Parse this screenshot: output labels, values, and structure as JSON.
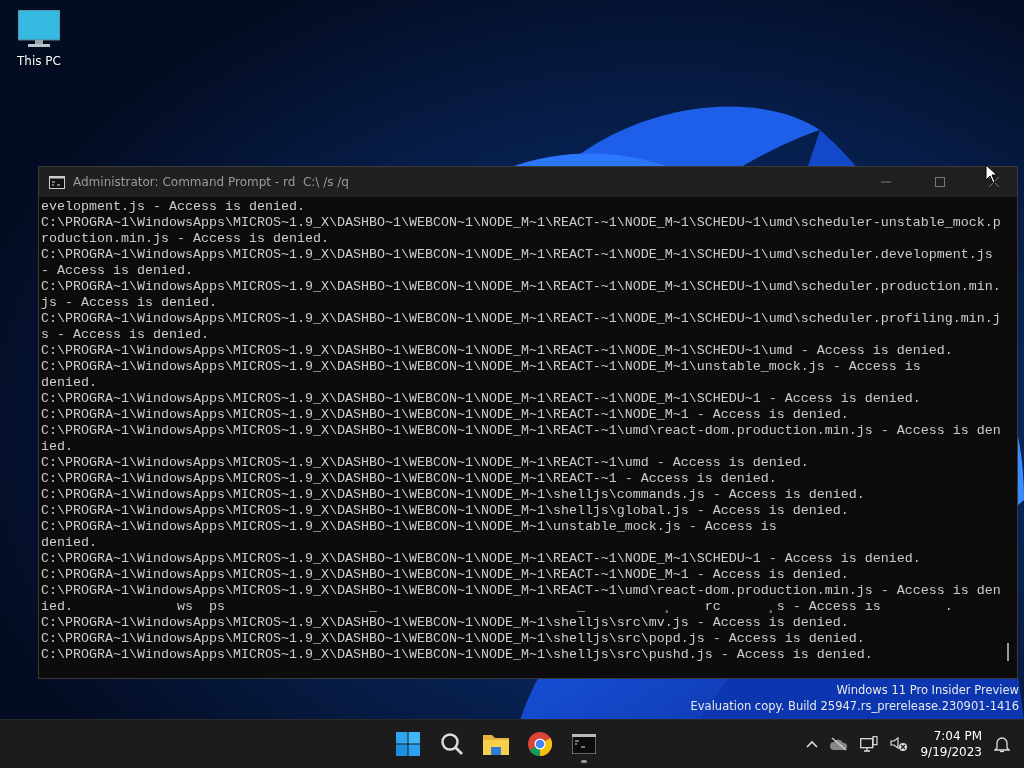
{
  "desktop_icons": [
    {
      "label": "This PC"
    }
  ],
  "window": {
    "title": "Administrator: Command Prompt - rd  C:\\ /s /q",
    "console_lines": [
      "evelopment.js - Access is denied.",
      "C:\\PROGRA~1\\WindowsApps\\MICROS~1.9_X\\DASHBO~1\\WEBCON~1\\NODE_M~1\\REACT-~1\\NODE_M~1\\SCHEDU~1\\umd\\scheduler-unstable_mock.p",
      "roduction.min.js - Access is denied.",
      "C:\\PROGRA~1\\WindowsApps\\MICROS~1.9_X\\DASHBO~1\\WEBCON~1\\NODE_M~1\\REACT-~1\\NODE_M~1\\SCHEDU~1\\umd\\scheduler.development.js",
      "- Access is denied.",
      "C:\\PROGRA~1\\WindowsApps\\MICROS~1.9_X\\DASHBO~1\\WEBCON~1\\NODE_M~1\\REACT-~1\\NODE_M~1\\SCHEDU~1\\umd\\scheduler.production.min.",
      "js - Access is denied.",
      "C:\\PROGRA~1\\WindowsApps\\MICROS~1.9_X\\DASHBO~1\\WEBCON~1\\NODE_M~1\\REACT-~1\\NODE_M~1\\SCHEDU~1\\umd\\scheduler.profiling.min.j",
      "s - Access is denied.",
      "C:\\PROGRA~1\\WindowsApps\\MICROS~1.9_X\\DASHBO~1\\WEBCON~1\\NODE_M~1\\REACT-~1\\NODE_M~1\\SCHEDU~1\\umd - Access is denied.",
      "C:\\PROGRA~1\\WindowsApps\\MICROS~1.9_X\\DASHBO~1\\WEBCON~1\\NODE_M~1\\REACT-~1\\NODE_M~1\\unstable_mock.js - Access is",
      "denied.",
      "C:\\PROGRA~1\\WindowsApps\\MICROS~1.9_X\\DASHBO~1\\WEBCON~1\\NODE_M~1\\REACT-~1\\NODE_M~1\\SCHEDU~1 - Access is denied.",
      "C:\\PROGRA~1\\WindowsApps\\MICROS~1.9_X\\DASHBO~1\\WEBCON~1\\NODE_M~1\\REACT-~1\\NODE_M~1 - Access is denied.",
      "C:\\PROGRA~1\\WindowsApps\\MICROS~1.9_X\\DASHBO~1\\WEBCON~1\\NODE_M~1\\REACT-~1\\umd\\react-dom.production.min.js - Access is den",
      "ied.",
      "C:\\PROGRA~1\\WindowsApps\\MICROS~1.9_X\\DASHBO~1\\WEBCON~1\\NODE_M~1\\REACT-~1\\umd - Access is denied.",
      "C:\\PROGRA~1\\WindowsApps\\MICROS~1.9_X\\DASHBO~1\\WEBCON~1\\NODE_M~1\\REACT-~1 - Access is denied.",
      "C:\\PROGRA~1\\WindowsApps\\MICROS~1.9_X\\DASHBO~1\\WEBCON~1\\NODE_M~1\\shelljs\\commands.js - Access is denied.",
      "C:\\PROGRA~1\\WindowsApps\\MICROS~1.9_X\\DASHBO~1\\WEBCON~1\\NODE_M~1\\shelljs\\global.js - Access is denied.",
      "C:\\PROGRA~1\\WindowsApps\\MICROS~1.9_X\\DASHBO~1\\WEBCON~1\\NODE_M~1\\unstable_mock.js - Access is",
      "denied.",
      "C:\\PROGRA~1\\WindowsApps\\MICROS~1.9_X\\DASHBO~1\\WEBCON~1\\NODE_M~1\\REACT-~1\\NODE_M~1\\SCHEDU~1 - Access is denied.",
      "C:\\PROGRA~1\\WindowsApps\\MICROS~1.9_X\\DASHBO~1\\WEBCON~1\\NODE_M~1\\REACT-~1\\NODE_M~1 - Access is denied.",
      "C:\\PROGRA~1\\WindowsApps\\MICROS~1.9_X\\DASHBO~1\\WEBCON~1\\NODE_M~1\\REACT-~1\\umd\\react-dom.production.min.js - Access is den",
      "ied.             ws  ps                  _                         _          ¸    rc      ¸s - Access ıs        .",
      "C:\\PROGRA~1\\WindowsApps\\MICROS~1.9_X\\DASHBO~1\\WEBCON~1\\NODE_M~1\\shelljs\\src\\mv.js - Access is denied.",
      "C:\\PROGRA~1\\WindowsApps\\MICROS~1.9_X\\DASHBO~1\\WEBCON~1\\NODE_M~1\\shelljs\\src\\popd.js - Access is denied.",
      "C:\\PROGRA~1\\WindowsApps\\MICROS~1.9_X\\DASHBO~1\\WEBCON~1\\NODE_M~1\\shelljs\\src\\pushd.js - Access is denied."
    ]
  },
  "watermark_lines": [
    "Windows 11 Pro Insider Preview",
    "Evaluation copy. Build 25947.rs_prerelease.230901-1416"
  ],
  "taskbar": {
    "apps": [
      {
        "kind": "start",
        "running": false
      },
      {
        "kind": "search",
        "running": false
      },
      {
        "kind": "folder",
        "running": false
      },
      {
        "kind": "browser",
        "running": false
      },
      {
        "kind": "terminal",
        "running": true
      }
    ],
    "time": "7:04 PM",
    "date": "9/19/2023"
  }
}
